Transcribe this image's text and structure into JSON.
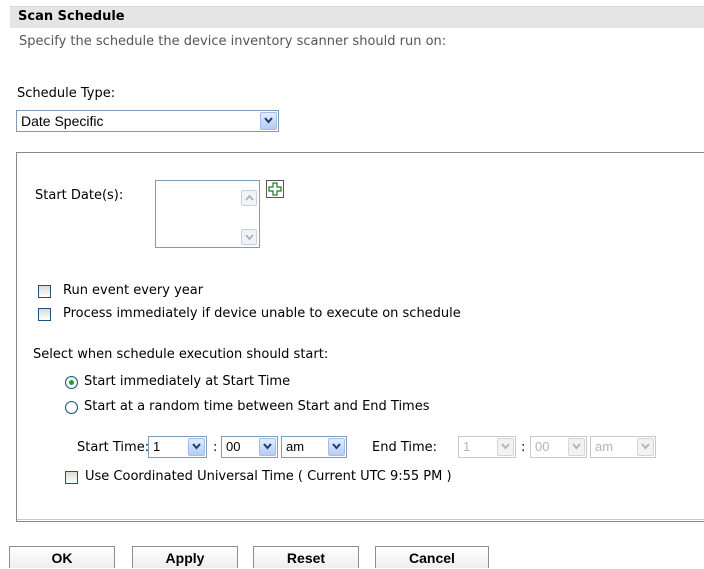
{
  "header": {
    "title": "Scan Schedule"
  },
  "description": "Specify the schedule the device inventory scanner should run on:",
  "schedule_type": {
    "label": "Schedule Type:",
    "selected": "Date Specific"
  },
  "start_dates": {
    "label": "Start Date(s):"
  },
  "options": {
    "run_every_year": {
      "label": "Run event every year",
      "checked": false
    },
    "process_immediately": {
      "label": "Process immediately if device unable to execute on schedule",
      "checked": false
    }
  },
  "execution": {
    "label": "Select when schedule execution should start:",
    "start_immediately": {
      "label": "Start immediately at Start Time",
      "selected": true
    },
    "start_random": {
      "label": "Start at a random time between Start and End Times",
      "selected": false
    }
  },
  "times": {
    "start_label": "Start Time:",
    "start_hour": "1",
    "start_minute": "00",
    "start_ampm": "am",
    "separator": ":",
    "end_label": "End Time:",
    "end_hour": "1",
    "end_minute": "00",
    "end_ampm": "am"
  },
  "utc": {
    "label": "Use Coordinated Universal Time ( Current UTC 9:55 PM )",
    "checked": false
  },
  "buttons": {
    "ok": "OK",
    "apply": "Apply",
    "reset": "Reset",
    "cancel": "Cancel"
  },
  "colors": {
    "radio_selected": "#21a121",
    "header_bg": "#e5e5e5",
    "field_border": "#7f9db9"
  }
}
